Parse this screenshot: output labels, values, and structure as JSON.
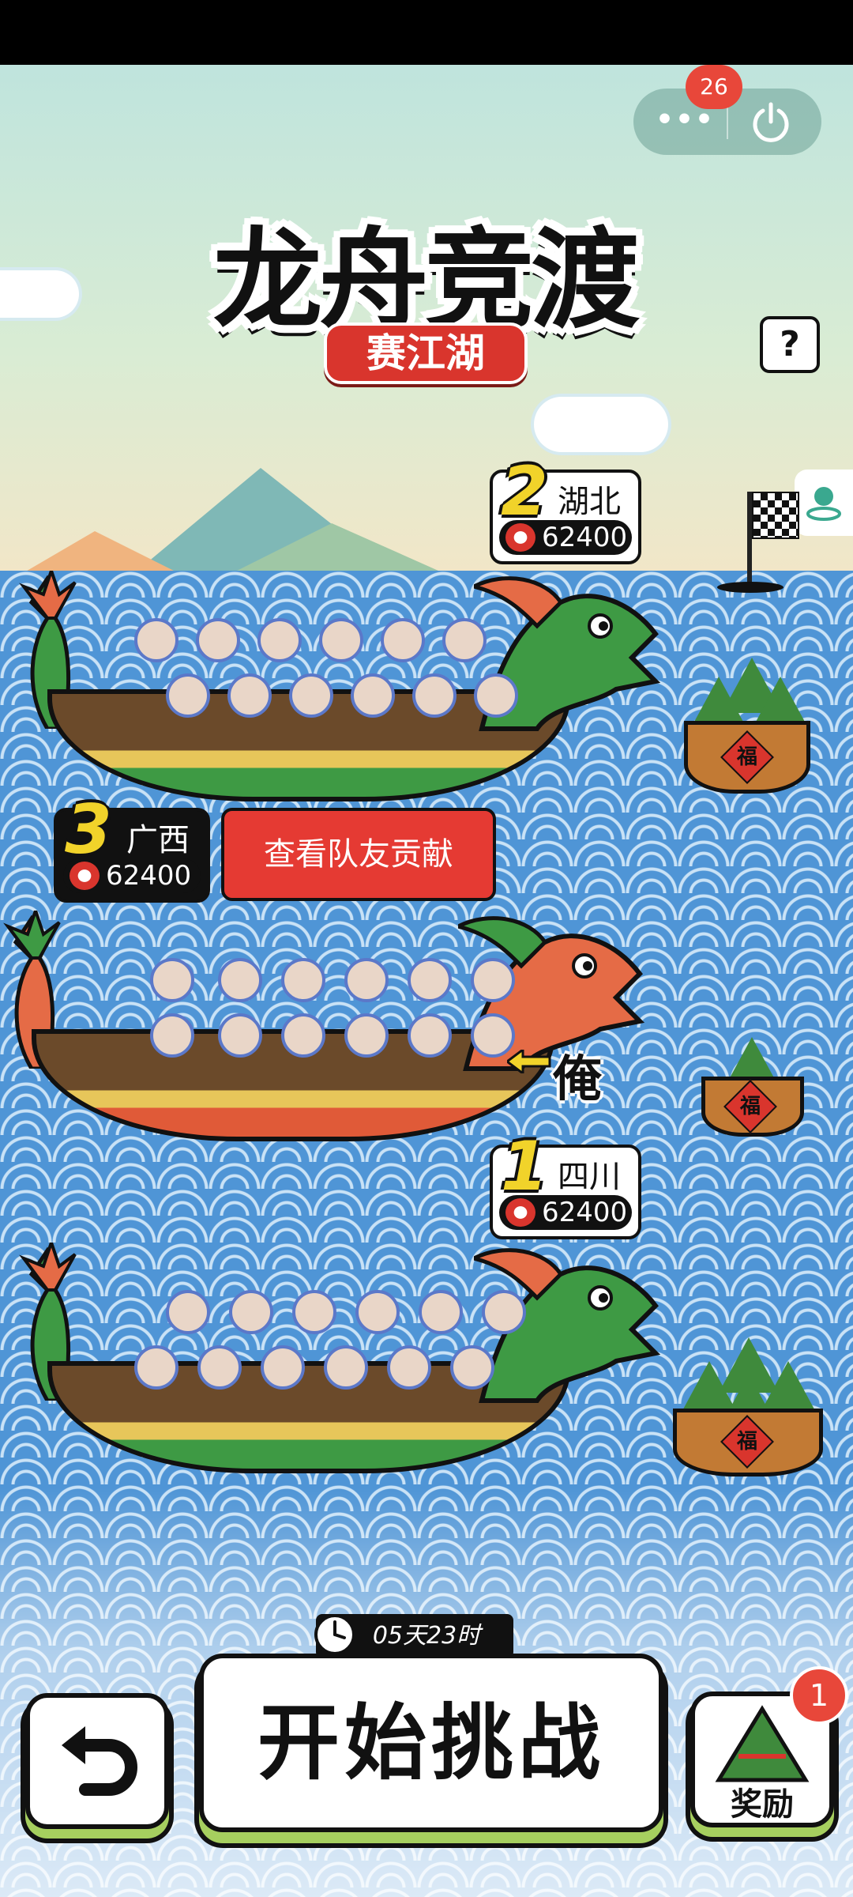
{
  "header": {
    "title": "龙舟竞渡",
    "subtitle": "赛江湖",
    "menu_label": "•••",
    "notification_count": "26",
    "help_label": "?"
  },
  "ranks": [
    {
      "rank": "2",
      "province": "湖北",
      "score": "62400"
    },
    {
      "rank": "3",
      "province": "广西",
      "score": "62400"
    },
    {
      "rank": "1",
      "province": "四川",
      "score": "62400"
    }
  ],
  "team": {
    "contribution_button": "查看队友贡献",
    "me_label": "俺"
  },
  "footer": {
    "timer": "05天23时",
    "start_button": "开始挑战",
    "reward_label": "奖励",
    "reward_badge": "1"
  },
  "colors": {
    "accent_red": "#e53a33",
    "water_blue": "#4f95d6",
    "button_green": "#a6cf5f",
    "rank_yellow": "#f1d32a"
  },
  "icons": [
    "menu-dots-icon",
    "power-icon",
    "help-icon",
    "location-icon",
    "flag-icon",
    "drum-icon",
    "clock-icon",
    "back-arrow-icon",
    "zongzi-icon"
  ]
}
